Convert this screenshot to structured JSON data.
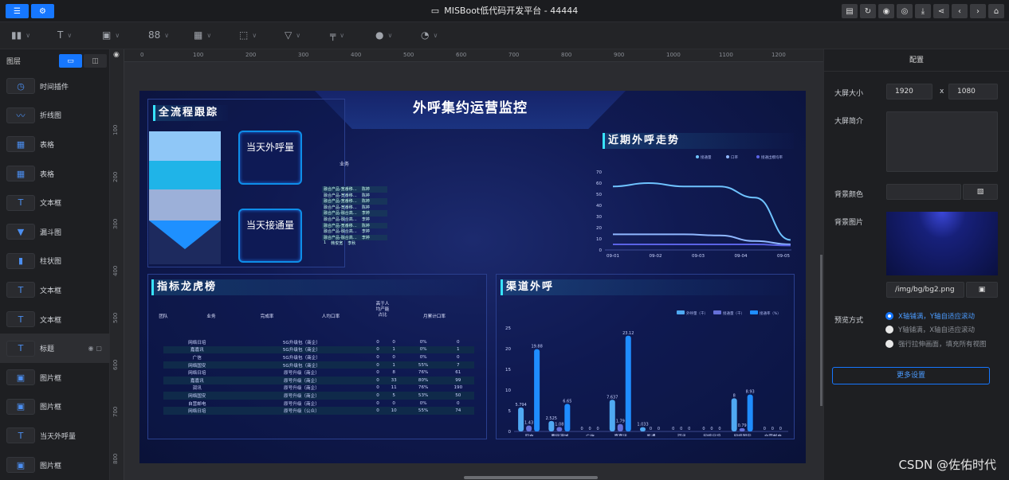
{
  "app": {
    "title": "MISBoot低代码开发平台 - 44444",
    "left_buttons": [
      "sliders-icon",
      "gear-icon"
    ],
    "right_buttons": [
      "document-icon",
      "refresh-icon",
      "camera-icon",
      "eye-icon",
      "download-icon",
      "share-icon",
      "back-icon",
      "forward-icon",
      "home-icon"
    ]
  },
  "toolbar": {
    "tools": [
      "bar-chart-icon",
      "text-icon",
      "image-icon",
      "table-icon",
      "grid-icon",
      "select-icon",
      "filter-icon",
      "brush-icon",
      "info-icon",
      "clock-icon"
    ]
  },
  "layers": {
    "header": "图层",
    "items": [
      {
        "label": "时间插件",
        "icon": "clock-icon",
        "glyph": "◷"
      },
      {
        "label": "折线图",
        "icon": "line-chart-icon",
        "glyph": "〰"
      },
      {
        "label": "表格",
        "icon": "table-icon",
        "glyph": "▦"
      },
      {
        "label": "表格",
        "icon": "table-icon",
        "glyph": "▦"
      },
      {
        "label": "文本框",
        "icon": "text-icon",
        "glyph": "T"
      },
      {
        "label": "漏斗图",
        "icon": "funnel-icon",
        "glyph": "▼"
      },
      {
        "label": "柱状图",
        "icon": "bar-chart-icon",
        "glyph": "▮"
      },
      {
        "label": "文本框",
        "icon": "text-icon",
        "glyph": "T"
      },
      {
        "label": "文本框",
        "icon": "text-icon",
        "glyph": "T"
      },
      {
        "label": "标题",
        "icon": "title-icon",
        "glyph": "T",
        "selected": true
      },
      {
        "label": "图片框",
        "icon": "image-icon",
        "glyph": "▣"
      },
      {
        "label": "图片框",
        "icon": "image-icon",
        "glyph": "▣"
      },
      {
        "label": "当天外呼量",
        "icon": "text-icon",
        "glyph": "T"
      },
      {
        "label": "图片框",
        "icon": "image-icon",
        "glyph": "▣"
      }
    ]
  },
  "ruler": {
    "h": [
      "0",
      "100",
      "200",
      "300",
      "400",
      "500",
      "600",
      "700",
      "800",
      "900",
      "1000",
      "1100",
      "1200"
    ],
    "v": [
      "100",
      "200",
      "300",
      "400",
      "500",
      "600",
      "700",
      "800"
    ]
  },
  "screen": {
    "title": "外呼集约运营监控",
    "flow_title": "全流程跟踪",
    "kpi1": "当天外呼量",
    "kpi2": "当天接通量",
    "mini_table_header": "业务",
    "mini_rows": [
      [
        "融合产品-宽番移…",
        "陈婷"
      ],
      [
        "融合产品-宽番移…",
        "陈婷"
      ],
      [
        "融合产品-宽番移…",
        "陈婷"
      ],
      [
        "融合产品-宽番移…",
        "陈婷"
      ],
      [
        "融合产品-融合高…",
        "李婷"
      ],
      [
        "融合产品-融合高…",
        "李婷"
      ],
      [
        "融合产品-宽番移…",
        "陈婷"
      ],
      [
        "融合产品-融合高…",
        "李婷"
      ],
      [
        "融合产品-融合高…",
        "李婷"
      ],
      [
        "1",
        "韩俊宽",
        "李秋"
      ]
    ],
    "trend_title": "近期外呼走势",
    "rank_title": "指标龙虎榜",
    "channel_title": "渠道外呼"
  },
  "trend_chart": {
    "type": "line",
    "legend": [
      "接通量",
      "口率",
      "接通出模均率"
    ],
    "x": [
      "09-01",
      "09-02",
      "09-03",
      "09-04",
      "09-05"
    ],
    "yticks": [
      "0",
      "10",
      "20",
      "30",
      "40",
      "50",
      "60",
      "70"
    ],
    "ylim": [
      0,
      70
    ],
    "series": [
      {
        "name": "接通量",
        "values": [
          57,
          60,
          57,
          57,
          47,
          9
        ],
        "color": "#6fc3ff"
      },
      {
        "name": "口率",
        "values": [
          14,
          14,
          14,
          13,
          8,
          5
        ],
        "color": "#8fb7ff"
      },
      {
        "name": "接通出模均率",
        "values": [
          5,
          5,
          5,
          5,
          5,
          4
        ],
        "color": "#5b63e6"
      }
    ]
  },
  "rank_table": {
    "headers": [
      "团队",
      "业务",
      "完成率",
      "人均口率",
      "高于人均产能占比",
      "月累计口率"
    ],
    "rows": [
      [
        "网络日培",
        "5G升级包（商企）",
        "0",
        "0",
        "0%",
        "0"
      ],
      [
        "嘉嘉讯",
        "5G升级包（商企）",
        "0",
        "1",
        "0%",
        "1"
      ],
      [
        "广信",
        "5G升级包（商企）",
        "0",
        "0",
        "0%",
        "0"
      ],
      [
        "网络国安",
        "5G升级包（商企）",
        "0",
        "1",
        "55%",
        "7"
      ],
      [
        "网络日培",
        "原号升级（商企）",
        "0",
        "8",
        "76%",
        "61"
      ],
      [
        "嘉嘉讯",
        "原号升级（商企）",
        "0",
        "33",
        "80%",
        "99"
      ],
      [
        "润讯",
        "原号升级（商企）",
        "0",
        "11",
        "76%",
        "190"
      ],
      [
        "网络国安",
        "原号升级（商企）",
        "0",
        "5",
        "53%",
        "50"
      ],
      [
        "自营邮电",
        "原号升级（商企）",
        "0",
        "0",
        "0%",
        "0"
      ],
      [
        "网络日培",
        "原号升级（公众）",
        "0",
        "10",
        "55%",
        "74"
      ]
    ]
  },
  "channel_chart": {
    "type": "bar",
    "legend": [
      "外呼量（千）",
      "接通量（千）",
      "接通率（%）"
    ],
    "categories": [
      "四充",
      "要网漫城",
      "广信",
      "嘉嘉讯",
      "凯通",
      "润迅",
      "网络日培",
      "网络国安",
      "自营邮电"
    ],
    "yticks": [
      "0",
      "5",
      "10",
      "15",
      "20",
      "25"
    ],
    "ylim": [
      0,
      25
    ],
    "series": [
      {
        "name": "外呼量（千）",
        "values": [
          5.794,
          2.525,
          0,
          7.637,
          1.033,
          0,
          0,
          8,
          0
        ],
        "labels": [
          "5.794",
          "2.525",
          "0",
          "7.637",
          "1.033",
          "0",
          "0",
          "8",
          "0"
        ]
      },
      {
        "name": "接通量（千）",
        "values": [
          1.43,
          1.08,
          0,
          1.79,
          0,
          0,
          0,
          0.79,
          0
        ],
        "labels": [
          "1.43",
          "1.08",
          "0",
          "1.79",
          "0",
          "0",
          "0",
          "0.79",
          "0"
        ]
      },
      {
        "name": "接通率（%）",
        "values": [
          19.88,
          6.65,
          0,
          23.12,
          0,
          0,
          0,
          8.93,
          0
        ],
        "labels": [
          "19.88",
          "6.65",
          "0",
          "23.12",
          "0",
          "0",
          "0",
          "8.93",
          "0"
        ]
      }
    ]
  },
  "config": {
    "header": "配置",
    "size_label": "大屏大小",
    "width": "1920",
    "x_sep": "x",
    "height": "1080",
    "desc_label": "大屏简介",
    "bgcolor_label": "背景颜色",
    "bgimg_label": "背景图片",
    "bgimg_path": "/img/bg/bg2.png",
    "preview_label": "预览方式",
    "preview_options": [
      "X轴铺满，Y轴自适应滚动",
      "Y轴铺满，X轴自适应滚动",
      "强行拉伸画面，填充所有视图"
    ],
    "more_btn": "更多设置"
  },
  "watermark": "CSDN @佐佑时代"
}
